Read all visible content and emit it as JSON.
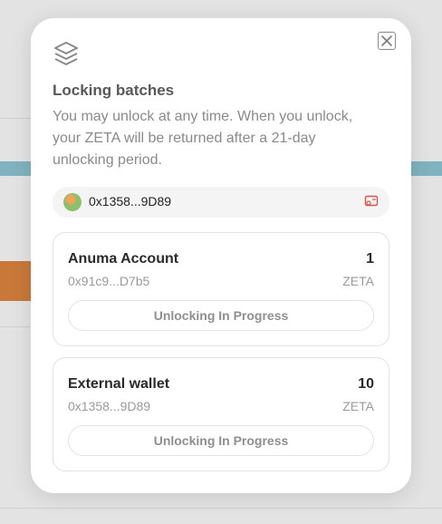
{
  "modal": {
    "title": "Locking batches",
    "description": "You may unlock at any time. When you unlock, your ZETA will be returned after a 21-day unlocking period.",
    "icons": {
      "header": "layers-icon",
      "close": "close-icon",
      "wallet": "wallet-card-icon"
    },
    "wallet": {
      "address": "0x1358...9D89"
    },
    "batches": [
      {
        "name": "Anuma Account",
        "address": "0x91c9...D7b5",
        "amount": "1",
        "token": "ZETA",
        "button": "Unlocking In Progress"
      },
      {
        "name": "External wallet",
        "address": "0x1358...9D89",
        "amount": "10",
        "token": "ZETA",
        "button": "Unlocking In Progress"
      }
    ]
  },
  "colors": {
    "overlay": "#dcdcdc",
    "modal_bg": "#ffffff",
    "accent_red": "#d9534f",
    "background_bar": "#7fb3bf",
    "background_orange": "#c9783a"
  }
}
